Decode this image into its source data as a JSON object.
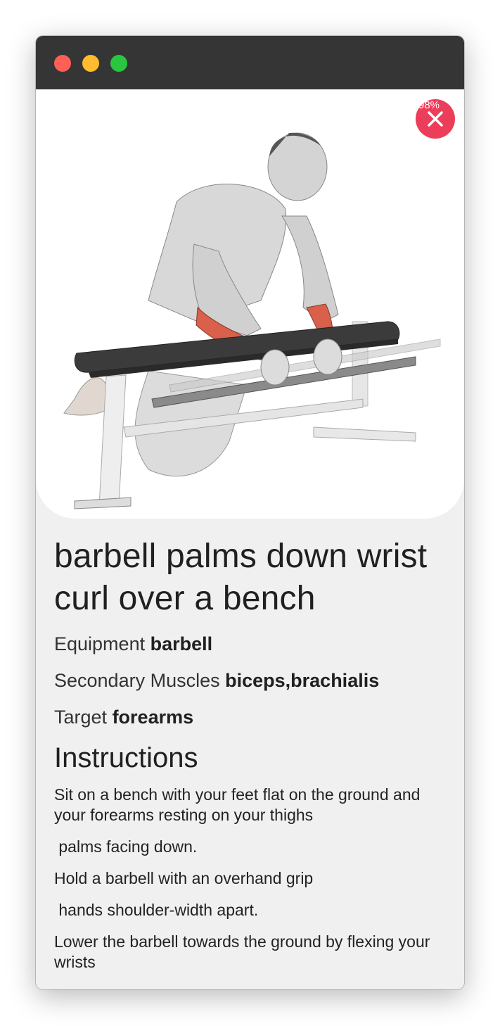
{
  "window": {
    "controls": [
      "close",
      "minimize",
      "zoom"
    ]
  },
  "hero": {
    "icon": "close-icon",
    "badge_text": "98%"
  },
  "exercise": {
    "title": "barbell palms down wrist curl over a bench",
    "equipment_label": "Equipment",
    "equipment_value": "barbell",
    "secondary_label": "Secondary Muscles",
    "secondary_value": "biceps,brachialis",
    "target_label": "Target",
    "target_value": "forearms"
  },
  "instructions": {
    "heading": "Instructions",
    "steps": [
      "Sit on a bench with your feet flat on the ground and your forearms resting on your thighs",
      " palms facing down.",
      "Hold a barbell with an overhand grip",
      " hands shoulder-width apart.",
      "Lower the barbell towards the ground by flexing your wrists"
    ]
  },
  "colors": {
    "accent": "#ec3d5a",
    "titlebar": "#353535",
    "background": "#f0f0f0",
    "muscle_highlight": "#d9604a"
  }
}
